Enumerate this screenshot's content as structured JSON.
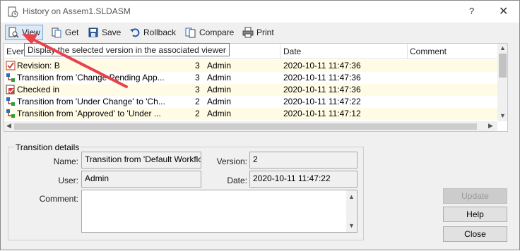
{
  "window": {
    "title": "History on Assem1.SLDASM",
    "help_glyph": "?",
    "close_glyph": "✕"
  },
  "toolbar": {
    "view": "View",
    "get": "Get",
    "save": "Save",
    "rollback": "Rollback",
    "compare": "Compare",
    "print": "Print"
  },
  "tooltip": "Display the selected version in the associated viewer",
  "grid": {
    "columns": [
      "Event",
      "Date",
      "Comment"
    ],
    "rows": [
      {
        "icon": "revision-icon",
        "event": "Revision: B",
        "version": "3",
        "user": "Admin",
        "date": "2020-10-11 11:47:36"
      },
      {
        "icon": "transition-icon",
        "event": "Transition from 'Change Pending App...",
        "version": "3",
        "user": "Admin",
        "date": "2020-10-11 11:47:36"
      },
      {
        "icon": "checked-in-icon",
        "event": "Checked in",
        "version": "3",
        "user": "Admin",
        "date": "2020-10-11 11:47:36"
      },
      {
        "icon": "transition-icon",
        "event": "Transition from 'Under Change' to 'Ch...",
        "version": "2",
        "user": "Admin",
        "date": "2020-10-11 11:47:22"
      },
      {
        "icon": "transition-icon",
        "event": "Transition from 'Approved' to 'Under ...",
        "version": "2",
        "user": "Admin",
        "date": "2020-10-11 11:47:12"
      }
    ]
  },
  "details": {
    "group_title": "Transition details",
    "name_label": "Name:",
    "name_value": "Transition from 'Default Workflow",
    "version_label": "Version:",
    "version_value": "2",
    "user_label": "User:",
    "user_value": "Admin",
    "date_label": "Date:",
    "date_value": "2020-10-11 11:47:22",
    "comment_label": "Comment:",
    "comment_value": ""
  },
  "buttons": {
    "update": "Update",
    "help": "Help",
    "close": "Close"
  },
  "colors": {
    "annotation_arrow": "#e8424b",
    "row_alt": "#fffbe5",
    "toolbar_active": "#dbe9f8"
  }
}
